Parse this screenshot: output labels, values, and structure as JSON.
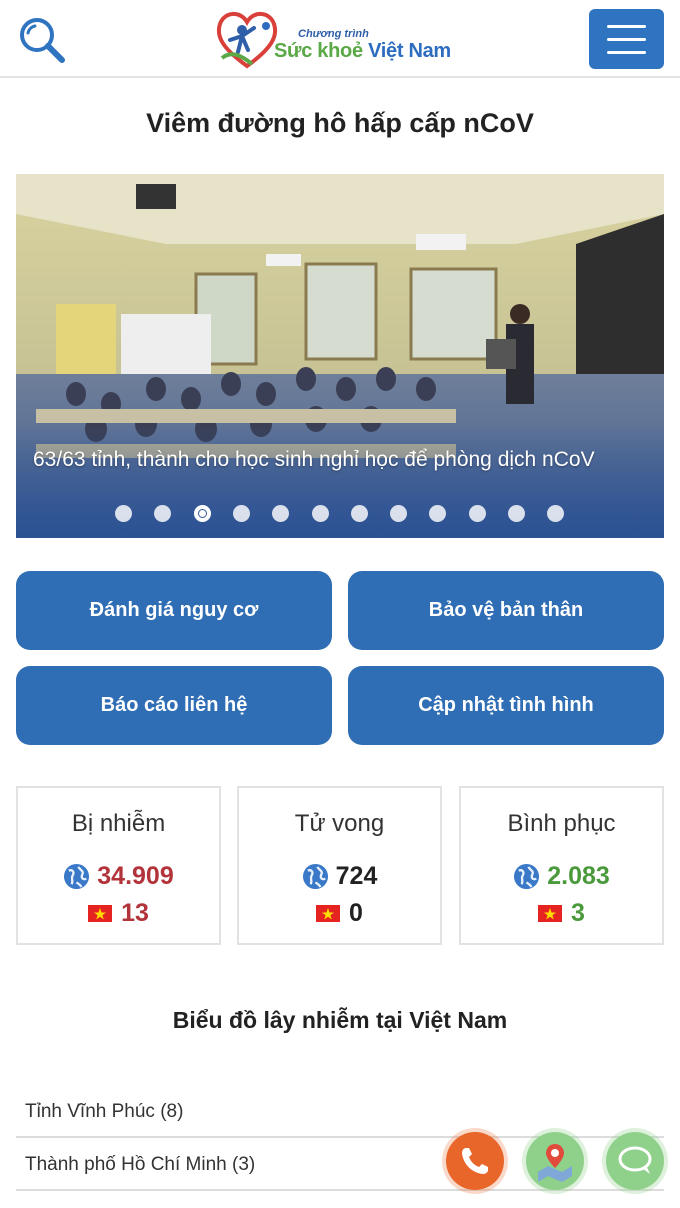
{
  "header": {
    "logo_small": "Chương trình",
    "logo_part1": "Sức khoẻ",
    "logo_part2": "Việt Nam"
  },
  "page_title": "Viêm đường hô hấp cấp nCoV",
  "slider": {
    "caption": "63/63 tỉnh, thành cho học sinh nghỉ học để phòng dịch nCoV",
    "dot_count": 12,
    "active_index": 2
  },
  "actions": [
    {
      "label": "Đánh giá nguy cơ"
    },
    {
      "label": "Bảo vệ bản thân"
    },
    {
      "label": "Báo cáo liên hệ"
    },
    {
      "label": "Cập nhật tình hình"
    }
  ],
  "stats": [
    {
      "title": "Bị nhiễm",
      "world": "34.909",
      "vietnam": "13",
      "color": "#b3333a"
    },
    {
      "title": "Tử vong",
      "world": "724",
      "vietnam": "0",
      "color": "#222222"
    },
    {
      "title": "Bình phục",
      "world": "2.083",
      "vietnam": "3",
      "color": "#4a9a3c"
    }
  ],
  "chart_section": {
    "title": "Biểu đồ lây nhiễm tại Việt Nam",
    "rows": [
      {
        "label": "Tỉnh Vĩnh Phúc (8)"
      },
      {
        "label": "Thành phố Hồ Chí Minh (3)"
      }
    ]
  },
  "colors": {
    "primary_blue": "#2f6db5",
    "phone_fab": "#e8662a",
    "map_fab": "#8fd08a",
    "chat_fab": "#8fd08a"
  },
  "icons": {
    "search": "search-icon",
    "menu": "hamburger-icon",
    "globe": "globe-icon",
    "flag": "vietnam-flag-icon",
    "phone": "phone-icon",
    "map": "map-pin-icon",
    "chat": "chat-icon"
  }
}
